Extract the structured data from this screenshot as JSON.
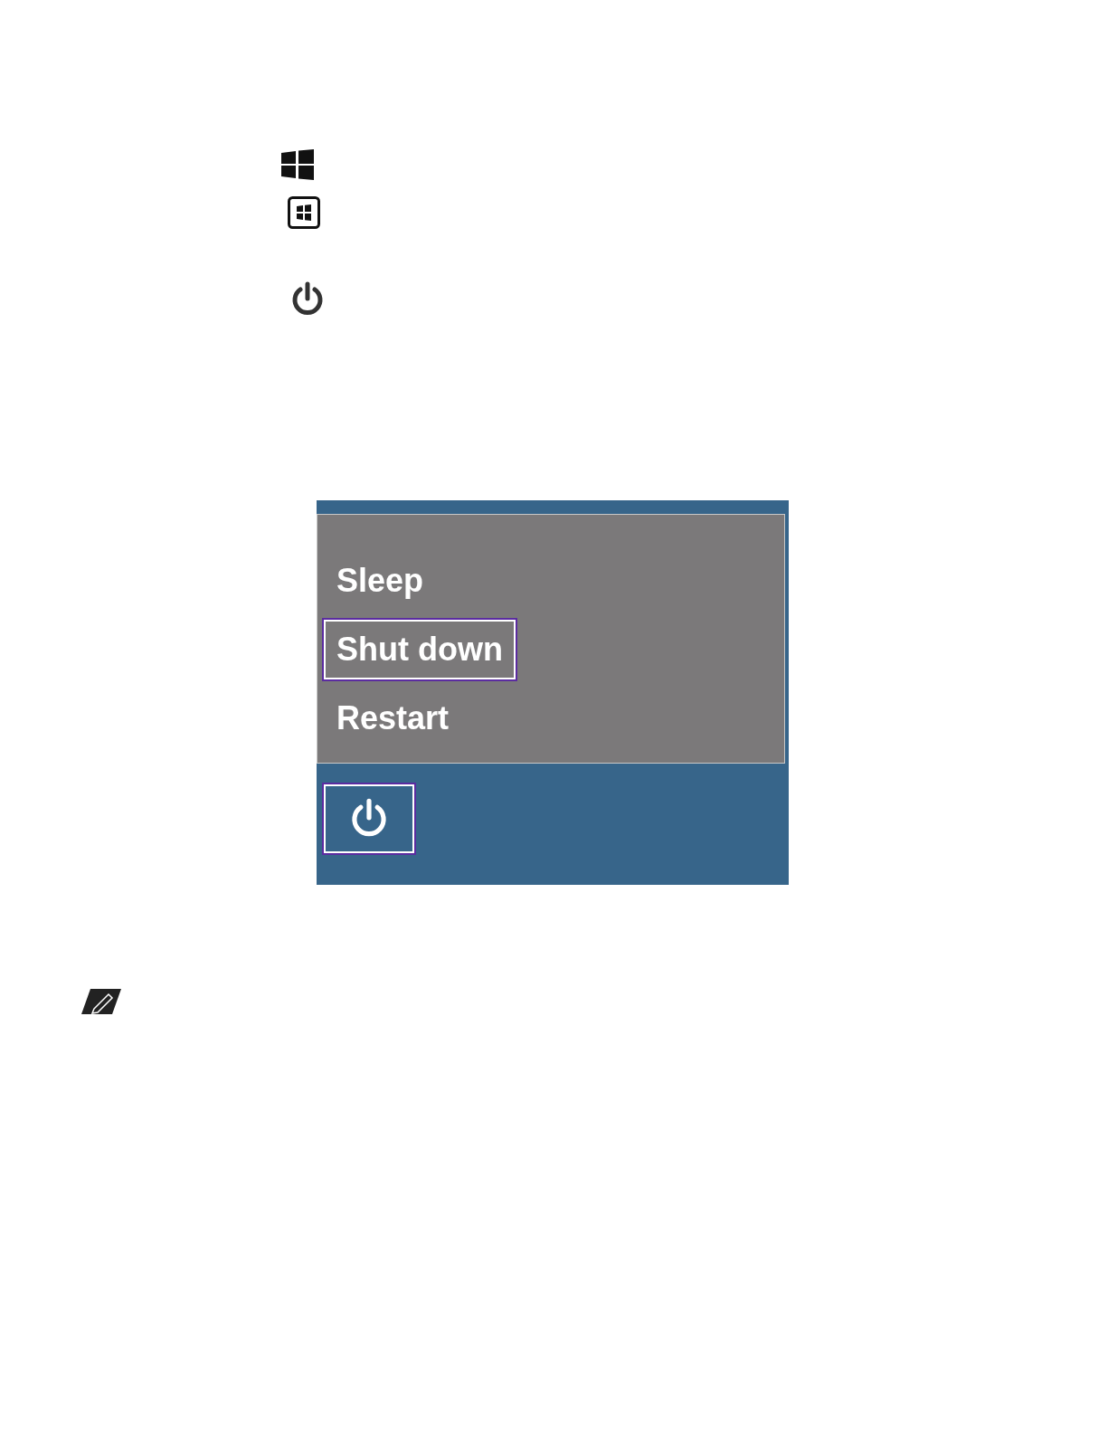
{
  "power_menu": {
    "items": [
      {
        "label": "Sleep",
        "selected": false
      },
      {
        "label": "Shut down",
        "selected": true
      },
      {
        "label": "Restart",
        "selected": false
      }
    ],
    "power_button": {
      "focused": true
    }
  }
}
